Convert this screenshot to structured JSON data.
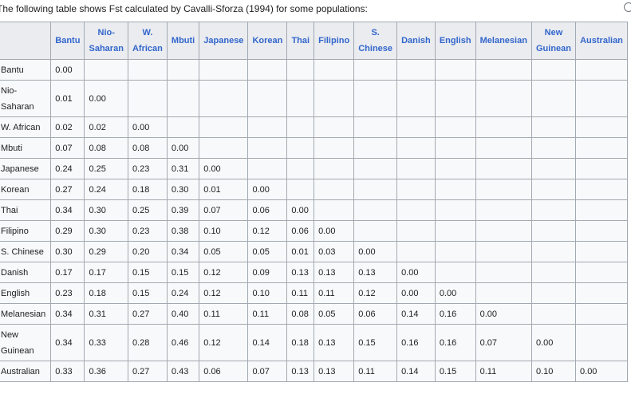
{
  "intro_text": "The following table shows Fst calculated by Cavalli-Sforza (1994) for some populations:",
  "columns": [
    {
      "label": "Bantu"
    },
    {
      "label": "Nio-Saharan"
    },
    {
      "label": "W. African"
    },
    {
      "label": "Mbuti"
    },
    {
      "label": "Japanese"
    },
    {
      "label": "Korean"
    },
    {
      "label": "Thai"
    },
    {
      "label": "Filipino"
    },
    {
      "label": "S. Chinese"
    },
    {
      "label": "Danish"
    },
    {
      "label": "English"
    },
    {
      "label": "Melanesian"
    },
    {
      "label": "New Guinean"
    },
    {
      "label": "Australian"
    }
  ],
  "rows": [
    {
      "label": "Bantu",
      "values": [
        "0.00"
      ]
    },
    {
      "label": "Nio-Saharan",
      "values": [
        "0.01",
        "0.00"
      ]
    },
    {
      "label": "W. African",
      "values": [
        "0.02",
        "0.02",
        "0.00"
      ]
    },
    {
      "label": "Mbuti",
      "values": [
        "0.07",
        "0.08",
        "0.08",
        "0.00"
      ]
    },
    {
      "label": "Japanese",
      "values": [
        "0.24",
        "0.25",
        "0.23",
        "0.31",
        "0.00"
      ]
    },
    {
      "label": "Korean",
      "values": [
        "0.27",
        "0.24",
        "0.18",
        "0.30",
        "0.01",
        "0.00"
      ]
    },
    {
      "label": "Thai",
      "values": [
        "0.34",
        "0.30",
        "0.25",
        "0.39",
        "0.07",
        "0.06",
        "0.00"
      ]
    },
    {
      "label": "Filipino",
      "values": [
        "0.29",
        "0.30",
        "0.23",
        "0.38",
        "0.10",
        "0.12",
        "0.06",
        "0.00"
      ]
    },
    {
      "label": "S. Chinese",
      "values": [
        "0.30",
        "0.29",
        "0.20",
        "0.34",
        "0.05",
        "0.05",
        "0.01",
        "0.03",
        "0.00"
      ]
    },
    {
      "label": "Danish",
      "values": [
        "0.17",
        "0.17",
        "0.15",
        "0.15",
        "0.12",
        "0.09",
        "0.13",
        "0.13",
        "0.13",
        "0.00"
      ]
    },
    {
      "label": "English",
      "values": [
        "0.23",
        "0.18",
        "0.15",
        "0.24",
        "0.12",
        "0.10",
        "0.11",
        "0.11",
        "0.12",
        "0.00",
        "0.00"
      ]
    },
    {
      "label": "Melanesian",
      "values": [
        "0.34",
        "0.31",
        "0.27",
        "0.40",
        "0.11",
        "0.11",
        "0.08",
        "0.05",
        "0.06",
        "0.14",
        "0.16",
        "0.00"
      ]
    },
    {
      "label": "New Guinean",
      "values": [
        "0.34",
        "0.33",
        "0.28",
        "0.46",
        "0.12",
        "0.14",
        "0.18",
        "0.13",
        "0.15",
        "0.16",
        "0.16",
        "0.07",
        "0.00"
      ]
    },
    {
      "label": "Australian",
      "values": [
        "0.33",
        "0.36",
        "0.27",
        "0.43",
        "0.06",
        "0.07",
        "0.13",
        "0.13",
        "0.11",
        "0.14",
        "0.15",
        "0.11",
        "0.10",
        "0.00"
      ]
    }
  ]
}
